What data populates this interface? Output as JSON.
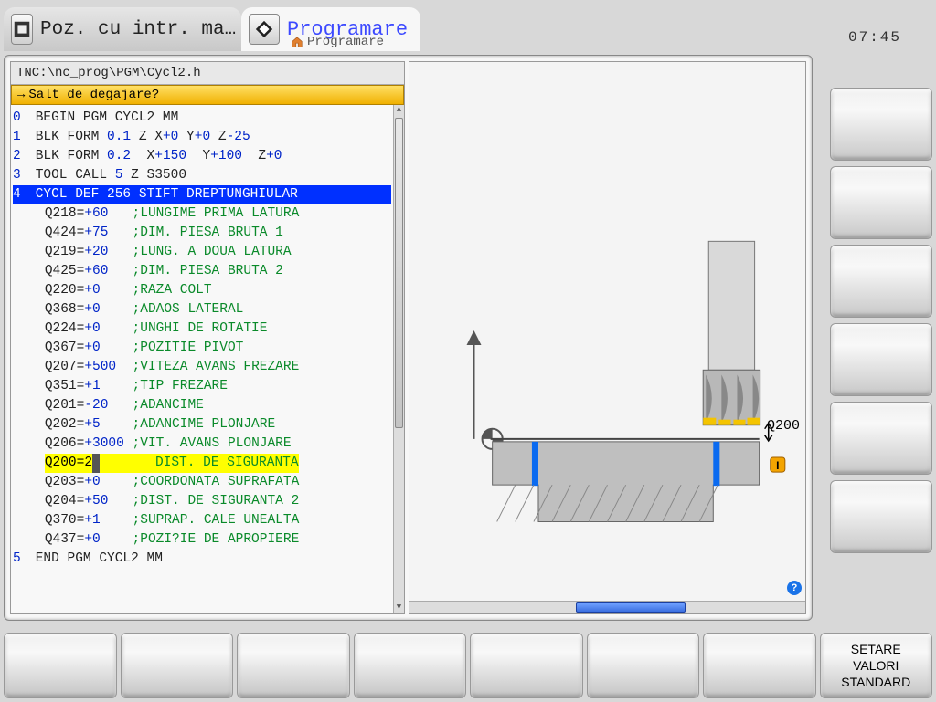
{
  "header": {
    "inactive_tab": "Poz. cu intr. ma…",
    "active_tab": "Programare",
    "breadcrumb": "Programare",
    "clock": "07:45"
  },
  "editor": {
    "path": "TNC:\\nc_prog\\PGM\\Cycl2.h",
    "prompt": "Salt de degajare?",
    "lines": {
      "l0_n": "0",
      "l0": "BEGIN PGM CYCL2 MM",
      "l1_n": "1",
      "l1_a": "BLK FORM ",
      "l1_b": "0.1",
      "l1_c": " Z X",
      "l1_d": "+0",
      "l1_e": " Y",
      "l1_f": "+0",
      "l1_g": " Z",
      "l1_h": "-25",
      "l2_n": "2",
      "l2_a": "BLK FORM ",
      "l2_b": "0.2",
      "l2_c": "  X",
      "l2_d": "+150",
      "l2_e": "  Y",
      "l2_f": "+100",
      "l2_g": "  Z",
      "l2_h": "+0",
      "l3_n": "3",
      "l3_a": "TOOL CALL ",
      "l3_b": "5",
      "l3_c": " Z S3500",
      "l4_n": "4",
      "l4": "CYCL DEF 256 STIFT DREPTUNGHIULAR",
      "p1_q": "Q218=",
      "p1_v": "+60",
      "p1_c": "   ;LUNGIME PRIMA LATURA",
      "p2_q": "Q424=",
      "p2_v": "+75",
      "p2_c": "   ;DIM. PIESA BRUTA 1",
      "p3_q": "Q219=",
      "p3_v": "+20",
      "p3_c": "   ;LUNG. A DOUA LATURA",
      "p4_q": "Q425=",
      "p4_v": "+60",
      "p4_c": "   ;DIM. PIESA BRUTA 2",
      "p5_q": "Q220=",
      "p5_v": "+0",
      "p5_c": "    ;RAZA COLT",
      "p6_q": "Q368=",
      "p6_v": "+0",
      "p6_c": "    ;ADAOS LATERAL",
      "p7_q": "Q224=",
      "p7_v": "+0",
      "p7_c": "    ;UNGHI DE ROTATIE",
      "p8_q": "Q367=",
      "p8_v": "+0",
      "p8_c": "    ;POZITIE PIVOT",
      "p9_q": "Q207=",
      "p9_v": "+500",
      "p9_c": "  ;VITEZA AVANS FREZARE",
      "p10_q": "Q351=",
      "p10_v": "+1",
      "p10_c": "    ;TIP FREZARE",
      "p11_q": "Q201=",
      "p11_v": "-20",
      "p11_c": "   ;ADANCIME",
      "p12_q": "Q202=",
      "p12_v": "+5",
      "p12_c": "    ;ADANCIME PLONJARE",
      "p13_q": "Q206=",
      "p13_v": "+3000",
      "p13_c": " ;VIT. AVANS PLONJARE",
      "p14_q": "Q200=2",
      "p14_c": "       DIST. DE SIGURANTA",
      "p15_q": "Q203=",
      "p15_v": "+0",
      "p15_c": "    ;COORDONATA SUPRAFATA",
      "p16_q": "Q204=",
      "p16_v": "+50",
      "p16_c": "   ;DIST. DE SIGURANTA 2",
      "p17_q": "Q370=",
      "p17_v": "+1",
      "p17_c": "    ;SUPRAP. CALE UNEALTA",
      "p18_q": "Q437=",
      "p18_v": "+0",
      "p18_c": "    ;POZI?IE DE APROPIERE",
      "l5_n": "5",
      "l5": "END PGM CYCL2 MM"
    }
  },
  "graphic": {
    "dim_label": "Q200",
    "info_badge": "I"
  },
  "softkeys": {
    "bottom_8": "SETARE\nVALORI\nSTANDARD"
  }
}
